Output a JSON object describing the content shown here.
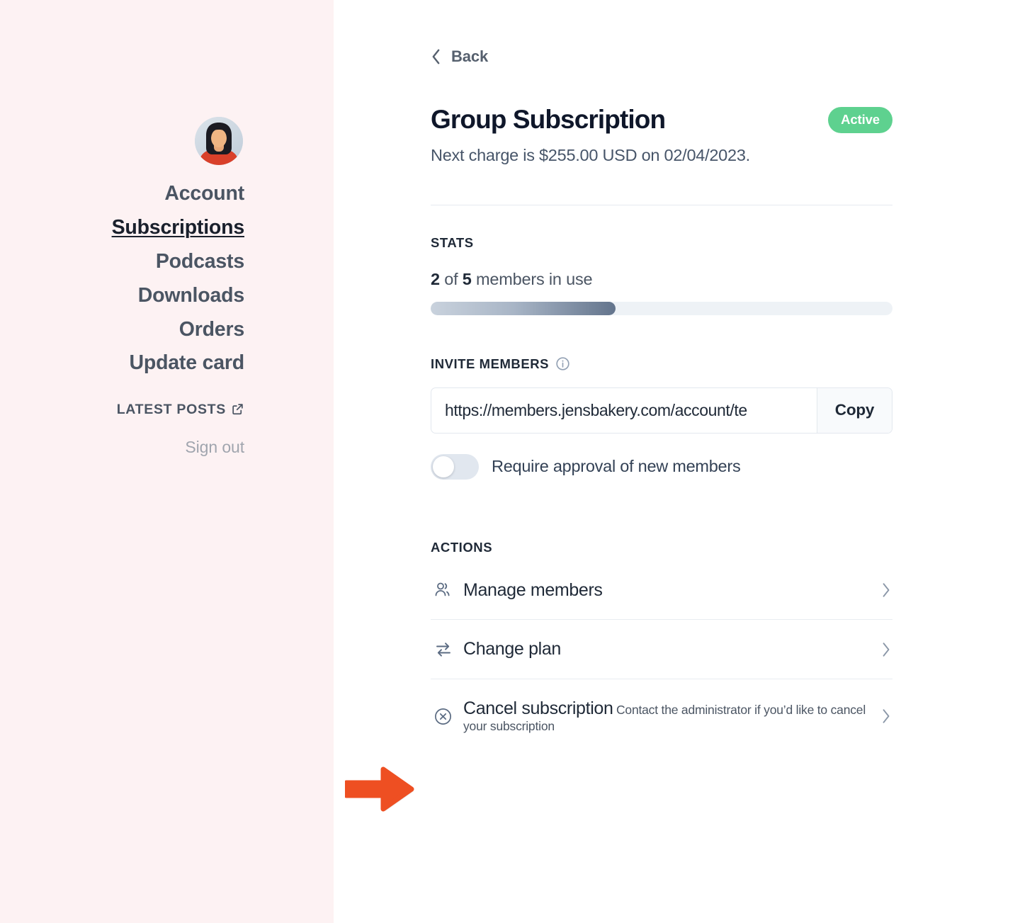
{
  "sidebar": {
    "avatar_alt": "user-avatar",
    "nav_items": [
      {
        "label": "Account",
        "active": false
      },
      {
        "label": "Subscriptions",
        "active": true
      },
      {
        "label": "Podcasts",
        "active": false
      },
      {
        "label": "Downloads",
        "active": false
      },
      {
        "label": "Orders",
        "active": false
      },
      {
        "label": "Update card",
        "active": false
      }
    ],
    "latest_posts_label": "LATEST POSTS",
    "latest_posts_icon": "external-link-icon",
    "sign_out_label": "Sign out"
  },
  "main": {
    "back_label": "Back",
    "back_icon": "chevron-left-icon",
    "title": "Group Subscription",
    "status_badge": "Active",
    "next_charge": "Next charge is $255.00 USD on 02/04/2023.",
    "stats": {
      "label": "STATS",
      "used": "2",
      "of_word": "of",
      "total": "5",
      "suffix": "members in use",
      "percent": 40
    },
    "invite": {
      "label": "INVITE MEMBERS",
      "info_icon": "info-circle-icon",
      "url_value": "https://members.jensbakery.com/account/te",
      "url_placeholder": "https://",
      "copy_label": "Copy",
      "toggle_label": "Require approval of new members",
      "toggle_on": false
    },
    "actions": {
      "label": "ACTIONS",
      "items": [
        {
          "icon": "users-icon",
          "title": "Manage members",
          "sub": "",
          "chevron": "chevron-right-icon"
        },
        {
          "icon": "exchange-arrows-icon",
          "title": "Change plan",
          "sub": "",
          "chevron": "chevron-right-icon"
        },
        {
          "icon": "cancel-circle-icon",
          "title": "Cancel subscription",
          "sub": "Contact the administrator if you’d like to cancel your subscription",
          "chevron": "chevron-right-icon"
        }
      ]
    }
  },
  "annotation": {
    "arrow_icon": "arrow-right-annotation",
    "color": "#ee4f22"
  },
  "colors": {
    "sidebar_bg": "#fdf2f3",
    "accent_green": "#5ed18f",
    "annotation_orange": "#ee4f22",
    "text_dark": "#1f2937",
    "text_muted": "#4b5563"
  }
}
